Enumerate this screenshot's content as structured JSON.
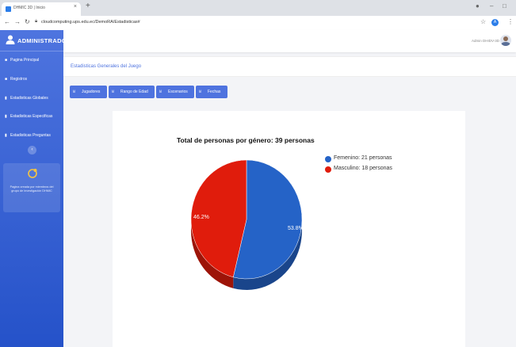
{
  "browser": {
    "tab_title": "DHMIC 3D | Inicio",
    "url": "cloudcomputing.ups.edu.ec/DemoRA/Estadisticas#"
  },
  "sidebar": {
    "brand": "ADMINISTRADOR",
    "items": [
      {
        "label": "Pagina Principal",
        "icon": "home-icon"
      },
      {
        "label": "Registros",
        "icon": "folder-icon"
      },
      {
        "label": "Estadisticas Globales",
        "icon": "bar-chart-icon"
      },
      {
        "label": "Estadisticas Especificas",
        "icon": "bar-chart-icon"
      },
      {
        "label": "Estadisticas Preguntas",
        "icon": "bar-chart-icon"
      }
    ],
    "toggle_symbol": "‹",
    "promo_text": "Pagina creada por miembros del grupo de investigación DHMIC"
  },
  "topbar": {
    "user_name": "Admin DHIDV-3D"
  },
  "content": {
    "page_title": "Estadisticas Generales del Juego",
    "buttons": [
      {
        "label": "Jugadores",
        "icon": "bar-chart-icon"
      },
      {
        "label": "Rango de Edad",
        "icon": "bar-chart-icon"
      },
      {
        "label": "Escenarios",
        "icon": "bar-chart-icon"
      },
      {
        "label": "Fechas",
        "icon": "bar-chart-icon"
      }
    ]
  },
  "chart_data": {
    "type": "pie",
    "title": "Total de personas por género: 39 personas",
    "slices": [
      {
        "name": "Femenino",
        "legend": "Femenino: 21 personas",
        "value": 21,
        "label": "53.8%",
        "color": "#2563c7"
      },
      {
        "name": "Masculino",
        "legend": "Masculino: 18 personas",
        "value": 18,
        "label": "46.2%",
        "color": "#e01c0c"
      }
    ],
    "legend_position": "top-right"
  },
  "colors": {
    "sidebar": "#4e73df",
    "accent": "#4e73df"
  }
}
